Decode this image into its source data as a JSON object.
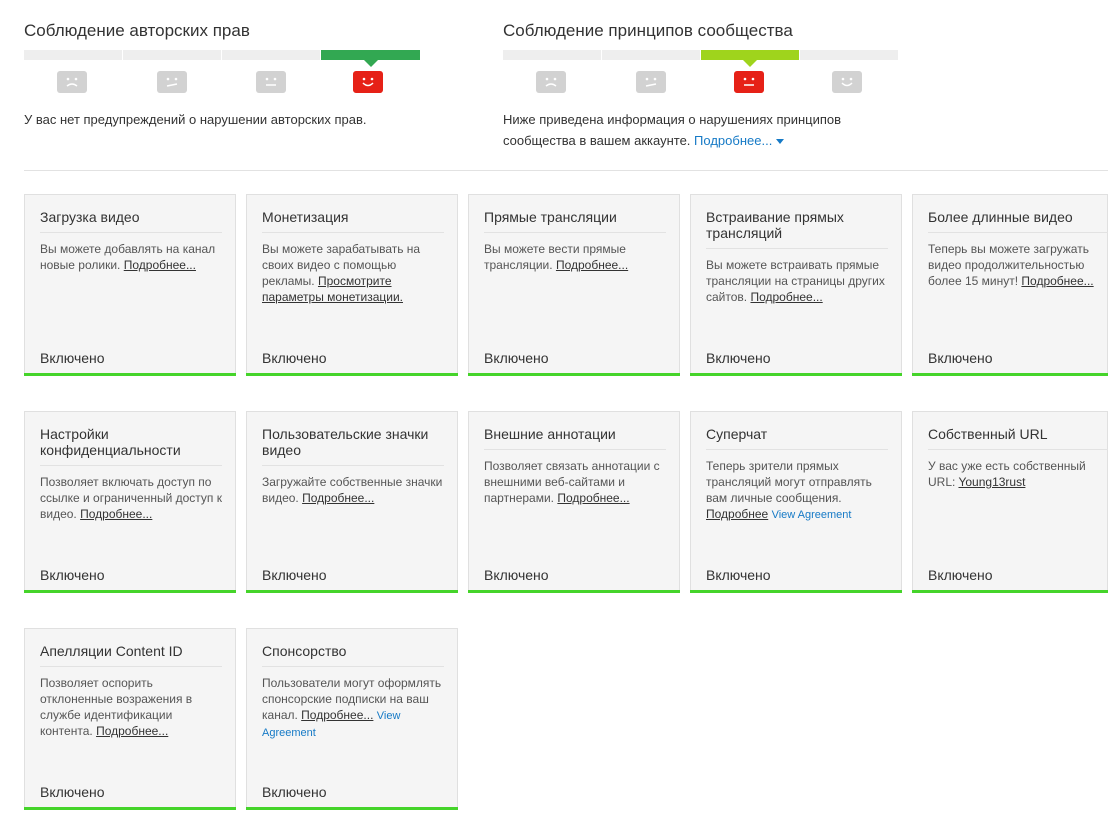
{
  "copyright": {
    "title": "Соблюдение авторских прав",
    "text": "У вас нет предупреждений о нарушении авторских прав."
  },
  "community": {
    "title": "Соблюдение принципов сообщества",
    "text_line1": "Ниже приведена информация о нарушениях принципов",
    "text_line2": "сообщества в вашем аккаунте.",
    "more_link": "Подробнее..."
  },
  "colors": {
    "copyright_active": "#32a852",
    "community_active": "#9fd41c",
    "face_red": "#e62117",
    "face_gray": "#d2d2d2",
    "status_green": "#45d42a",
    "link_blue": "#167ac6"
  },
  "cards": [
    {
      "title": "Загрузка видео",
      "desc": "Вы можете добавлять на канал новые ролики.",
      "link": "Подробнее...",
      "status": "Включено"
    },
    {
      "title": "Монетизация",
      "desc": "Вы можете зарабатывать на своих видео с помощью рекламы.",
      "link": "Просмотрите параметры монетизации.",
      "status": "Включено"
    },
    {
      "title": "Прямые трансляции",
      "desc": "Вы можете вести прямые трансляции.",
      "link": "Подробнее...",
      "status": "Включено"
    },
    {
      "title": "Встраивание прямых трансляций",
      "desc": "Вы можете встраивать прямые трансляции на страницы других сайтов.",
      "link": "Подробнее...",
      "status": "Включено"
    },
    {
      "title": "Более длинные видео",
      "desc": "Теперь вы можете загружать видео продолжительностью более 15 минут!",
      "link": "Подробнее...",
      "status": "Включено"
    },
    {
      "title": "Настройки конфиденциальности",
      "desc": "Позволяет включать доступ по ссылке и ограниченный доступ к видео.",
      "link": "Подробнее...",
      "status": "Включено"
    },
    {
      "title": "Пользовательские значки видео",
      "desc": "Загружайте собственные значки видео.",
      "link": "Подробнее...",
      "status": "Включено"
    },
    {
      "title": "Внешние аннотации",
      "desc": "Позволяет связать аннотации с внешними веб-сайтами и партнерами.",
      "link": "Подробнее...",
      "status": "Включено"
    },
    {
      "title": "Суперчат",
      "desc": "Теперь зрители прямых трансляций могут отправлять вам личные сообщения.",
      "link": "Подробнее",
      "agreement": "View Agreement",
      "status": "Включено"
    },
    {
      "title": "Собственный URL",
      "desc": "У вас уже есть собственный URL:",
      "link": "Young13rust",
      "status": "Включено"
    },
    {
      "title": "Апелляции Content ID",
      "desc": "Позволяет оспорить отклоненные возражения в службе идентификации контента.",
      "link": "Подробнее...",
      "status": "Включено"
    },
    {
      "title": "Спонсорство",
      "desc": "Пользователи могут оформлять спонсорские подписки на ваш канал.",
      "link": "Подробнее...",
      "agreement": "View Agreement",
      "status": "Включено"
    }
  ]
}
